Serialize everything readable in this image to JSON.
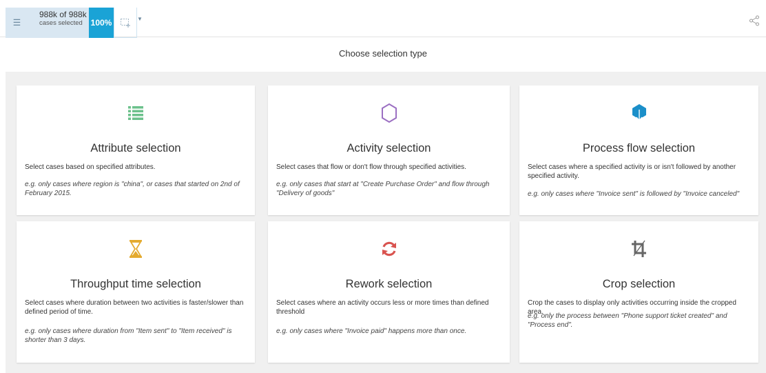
{
  "toolbar": {
    "menu_icon": "hamburger-icon",
    "selected_count": "988k of 988k",
    "selected_label": "cases selected",
    "percent": "100%",
    "selection_tool_icon": "crop-select-icon",
    "share_icon": "share-icon"
  },
  "heading": "Choose selection type",
  "cards": [
    {
      "title": "Attribute selection",
      "description": "Select cases based on specified attributes.",
      "example": "e.g. only cases where region is \"china\", or cases that started on 2nd of February 2015.",
      "icon": "list-icon",
      "color": "#6cc18c"
    },
    {
      "title": "Activity selection",
      "description": "Select cases that flow or don't flow through specified activities.",
      "example": "e.g. only cases that start at \"Create Purchase Order\" and flow through \"Delivery of goods\"",
      "icon": "hexagon-icon",
      "color": "#9b6fc2"
    },
    {
      "title": "Process flow selection",
      "description": "Select cases where a specified activity is or isn't followed by another specified activity.",
      "example": "e.g. only cases where \"Invoice sent\" is followed by \"Invoice canceled\"",
      "icon": "process-flow-icon",
      "color": "#1b8fc9"
    },
    {
      "title": "Throughput time selection",
      "description": "Select cases where duration between two activities is faster/slower than defined period of time.",
      "example": "e.g. only cases where duration from \"Item sent\" to \"Item received\" is shorter than 3 days.",
      "icon": "hourglass-icon",
      "color": "#e4aa2f"
    },
    {
      "title": "Rework selection",
      "description": "Select cases where an activity occurs less or more times than defined threshold",
      "example": "e.g. only cases where \"Invoice paid\" happens more than once.",
      "icon": "refresh-icon",
      "color": "#d9534f"
    },
    {
      "title": "Crop selection",
      "description": "Crop the cases to display only activities occurring inside the cropped area.",
      "example": "e.g. only the process between \"Phone support ticket created\" and \"Process end\".",
      "icon": "crop-icon",
      "color": "#666666"
    }
  ]
}
